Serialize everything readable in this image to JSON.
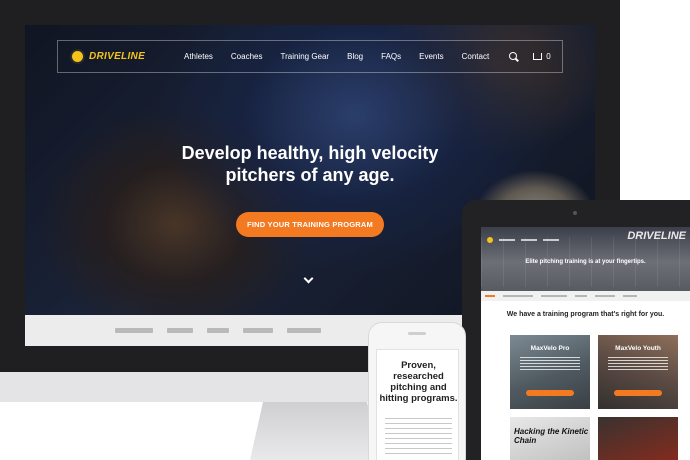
{
  "desktop": {
    "nav": {
      "brand": "DRIVELINE",
      "links": [
        "Athletes",
        "Coaches",
        "Training Gear",
        "Blog",
        "FAQs",
        "Events",
        "Contact"
      ],
      "cart_count": "0"
    },
    "hero": {
      "title_line1": "Develop healthy, high velocity",
      "title_line2": "pitchers of any age.",
      "cta_label": "FIND YOUR TRAINING PROGRAM"
    }
  },
  "tablet": {
    "brand": "DRIVELINE",
    "hero_text": "Elite pitching training is at your fingertips.",
    "section_heading": "We have a training program that's right for you.",
    "cards": [
      {
        "title": "MaxVelo Pro"
      },
      {
        "title": "MaxVelo Youth"
      }
    ],
    "book_text": "Hacking the Kinetic Chain"
  },
  "phone": {
    "heading": "Proven, researched pitching and hitting programs."
  },
  "colors": {
    "accent": "#f47a22",
    "brand_yellow": "#f5c31a",
    "device_dark": "#1f1f21"
  }
}
